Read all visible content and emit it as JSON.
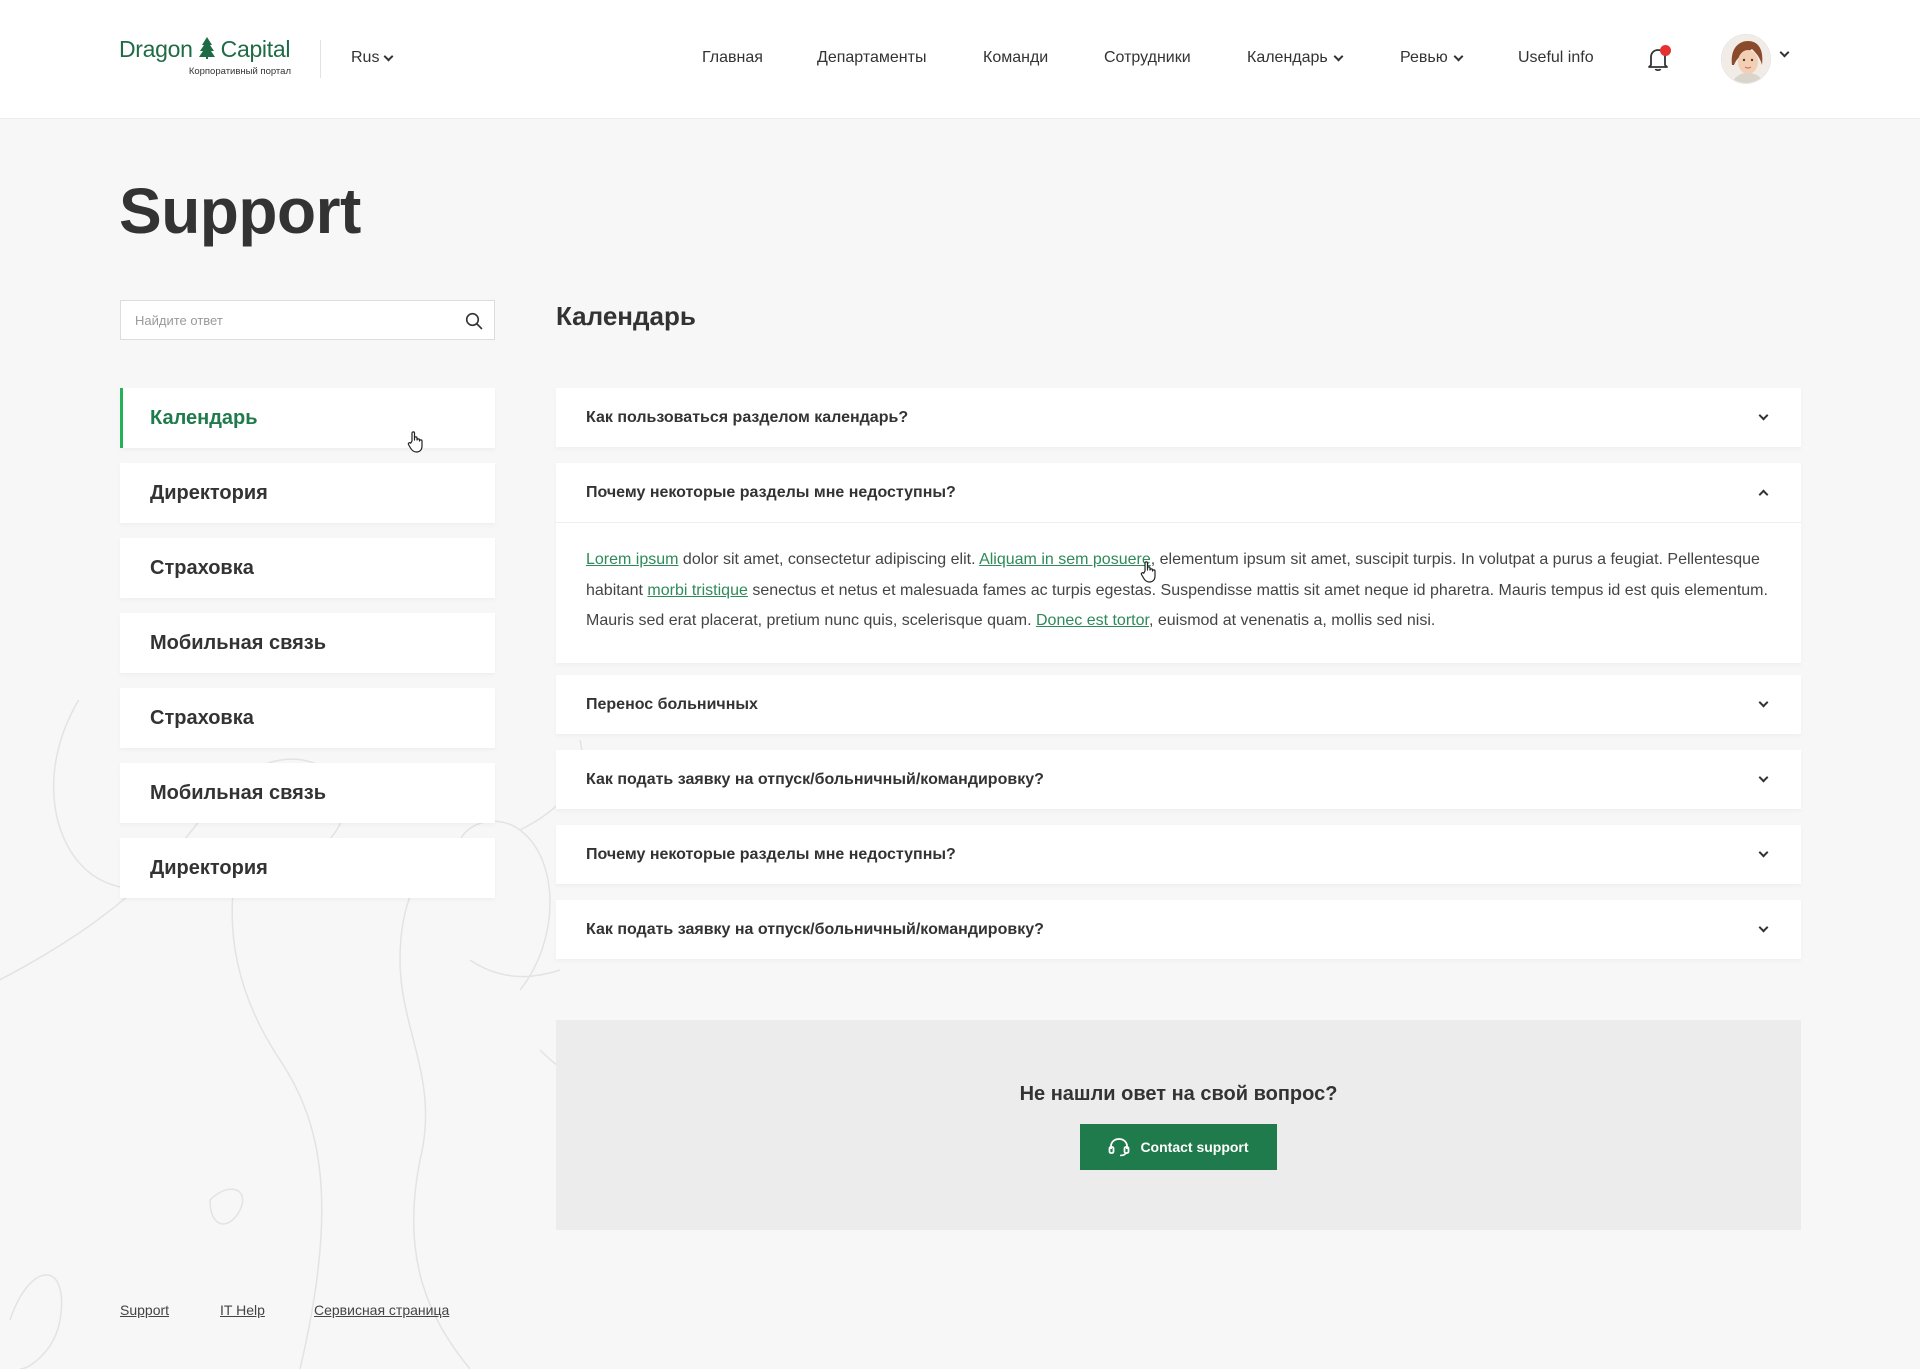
{
  "header": {
    "logo_text_1": "Dragon",
    "logo_text_2": "Capital",
    "logo_subtitle": "Корпоративный портал",
    "language": "Rus",
    "nav": [
      {
        "label": "Главная",
        "dropdown": false
      },
      {
        "label": "Департаменты",
        "dropdown": false
      },
      {
        "label": "Команди",
        "dropdown": false
      },
      {
        "label": "Сотрудники",
        "dropdown": false
      },
      {
        "label": "Календарь",
        "dropdown": true
      },
      {
        "label": "Ревью",
        "dropdown": true
      },
      {
        "label": "Useful info",
        "dropdown": false
      }
    ],
    "notification_badge_color": "#e53131"
  },
  "page": {
    "title": "Support"
  },
  "search": {
    "placeholder": "Найдите ответ",
    "icon": "search-icon"
  },
  "sidebar": {
    "items": [
      {
        "label": "Календарь",
        "active": true
      },
      {
        "label": "Директория",
        "active": false
      },
      {
        "label": "Страховка",
        "active": false
      },
      {
        "label": "Мобильная связь",
        "active": false
      },
      {
        "label": "Страховка",
        "active": false
      },
      {
        "label": "Мобильная связь",
        "active": false
      },
      {
        "label": "Директория",
        "active": false
      }
    ]
  },
  "section": {
    "title": "Календарь"
  },
  "faq": {
    "items": [
      {
        "question": "Как пользоваться разделом календарь?",
        "expanded": false
      },
      {
        "question": "Почему некоторые разделы мне недоступны?",
        "expanded": true
      },
      {
        "question": "Перенос больничных",
        "expanded": false
      },
      {
        "question": "Как подать заявку на отпуск/больничный/командировку?",
        "expanded": false
      },
      {
        "question": "Почему некоторые разделы мне недоступны?",
        "expanded": false
      },
      {
        "question": "Как подать заявку на отпуск/больничный/командировку?",
        "expanded": false
      }
    ],
    "answer": {
      "link_1": "Lorem ipsum",
      "text_1": " dolor sit amet, consectetur adipiscing elit. ",
      "link_2": "Aliquam in sem posuere",
      "text_2": ", elementum ipsum sit amet, suscipit turpis. In volutpat a purus a feugiat. Pellentesque habitant ",
      "link_3": "morbi tristique",
      "text_3": " senectus et netus et malesuada fames ac turpis egestas. Suspendisse mattis sit amet neque id pharetra. Mauris tempus id est quis elementum. Mauris sed erat placerat, pretium nunc quis, scelerisque quam. ",
      "link_4": "Donec est tortor",
      "text_4": ", euismod at venenatis a, mollis sed nisi."
    }
  },
  "cta": {
    "title": "Не нашли овет на свой вопрос?",
    "button_label": "Contact support",
    "button_icon": "headset-icon",
    "accent_color": "#1f7a4c"
  },
  "footer": {
    "links": [
      "Support",
      "IT Help",
      "Сервисная страница"
    ]
  }
}
